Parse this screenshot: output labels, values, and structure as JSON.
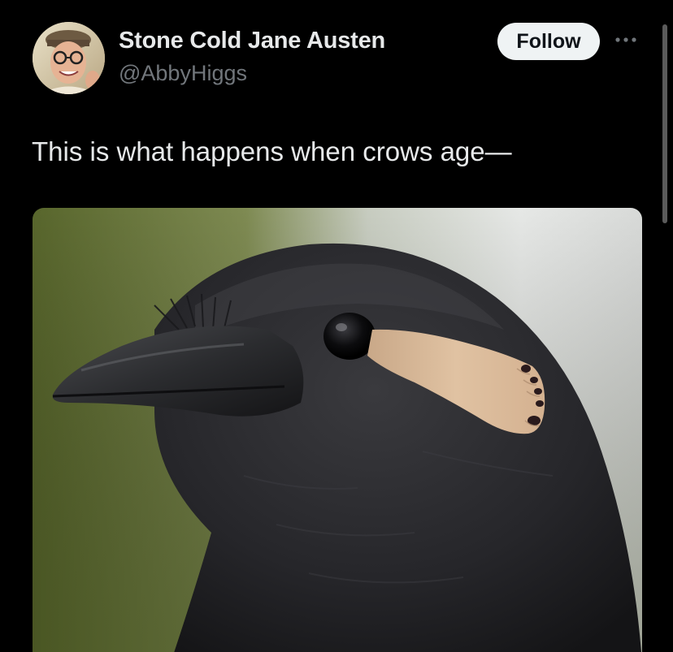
{
  "tweet": {
    "author": {
      "display_name": "Stone Cold Jane Austen",
      "handle": "@AbbyHiggs",
      "avatar_icon": "profile-photo"
    },
    "follow_label": "Follow",
    "more_icon": "more-horizontal-icon",
    "text": "This is what happens when crows age—",
    "media": {
      "description_icon": "crow-photo"
    }
  },
  "theme": {
    "background": "#000000",
    "text_primary": "#e7e9ea",
    "text_secondary": "#71767b",
    "follow_bg": "#eff3f4",
    "follow_text": "#0f1419"
  }
}
